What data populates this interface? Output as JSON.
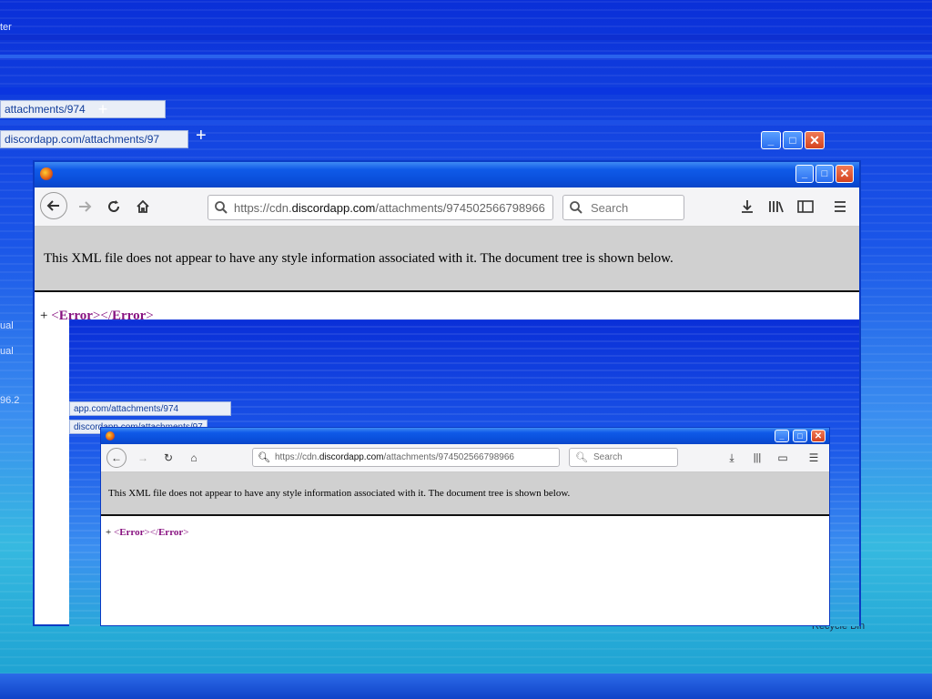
{
  "desktop": {
    "labels": [
      "ter",
      "ual",
      "ual",
      "96.2",
      "Recycle Bin"
    ]
  },
  "ghost_tabs": {
    "tab1": "attachments/974",
    "tab2": "app.com/attachments/97",
    "tab3": "discordapp.com/attachments/97",
    "tab4": "app.com/attachments/974",
    "tab5": "discordapp.com/attachments/97"
  },
  "browser": {
    "url_prefix": "https://cdn.",
    "url_host": "discordapp.com",
    "url_path": "/attachments/974502566798966",
    "search_placeholder": "Search",
    "xml_notice": "This XML file does not appear to have any style information associated with it. The document tree is shown below.",
    "tree_toggle": "+",
    "tree_open_tag": "Error",
    "tree_close_tag": "Error",
    "lt": "<",
    "gt": ">",
    "lt_slash": "</"
  },
  "icons": {
    "back": "back-arrow-icon",
    "forward": "forward-arrow-icon",
    "reload": "reload-icon",
    "home": "home-icon",
    "lock": "search-lens-icon",
    "download": "download-icon",
    "library": "library-icon",
    "sidebar": "sidebar-icon",
    "menu": "hamburger-menu-icon"
  }
}
